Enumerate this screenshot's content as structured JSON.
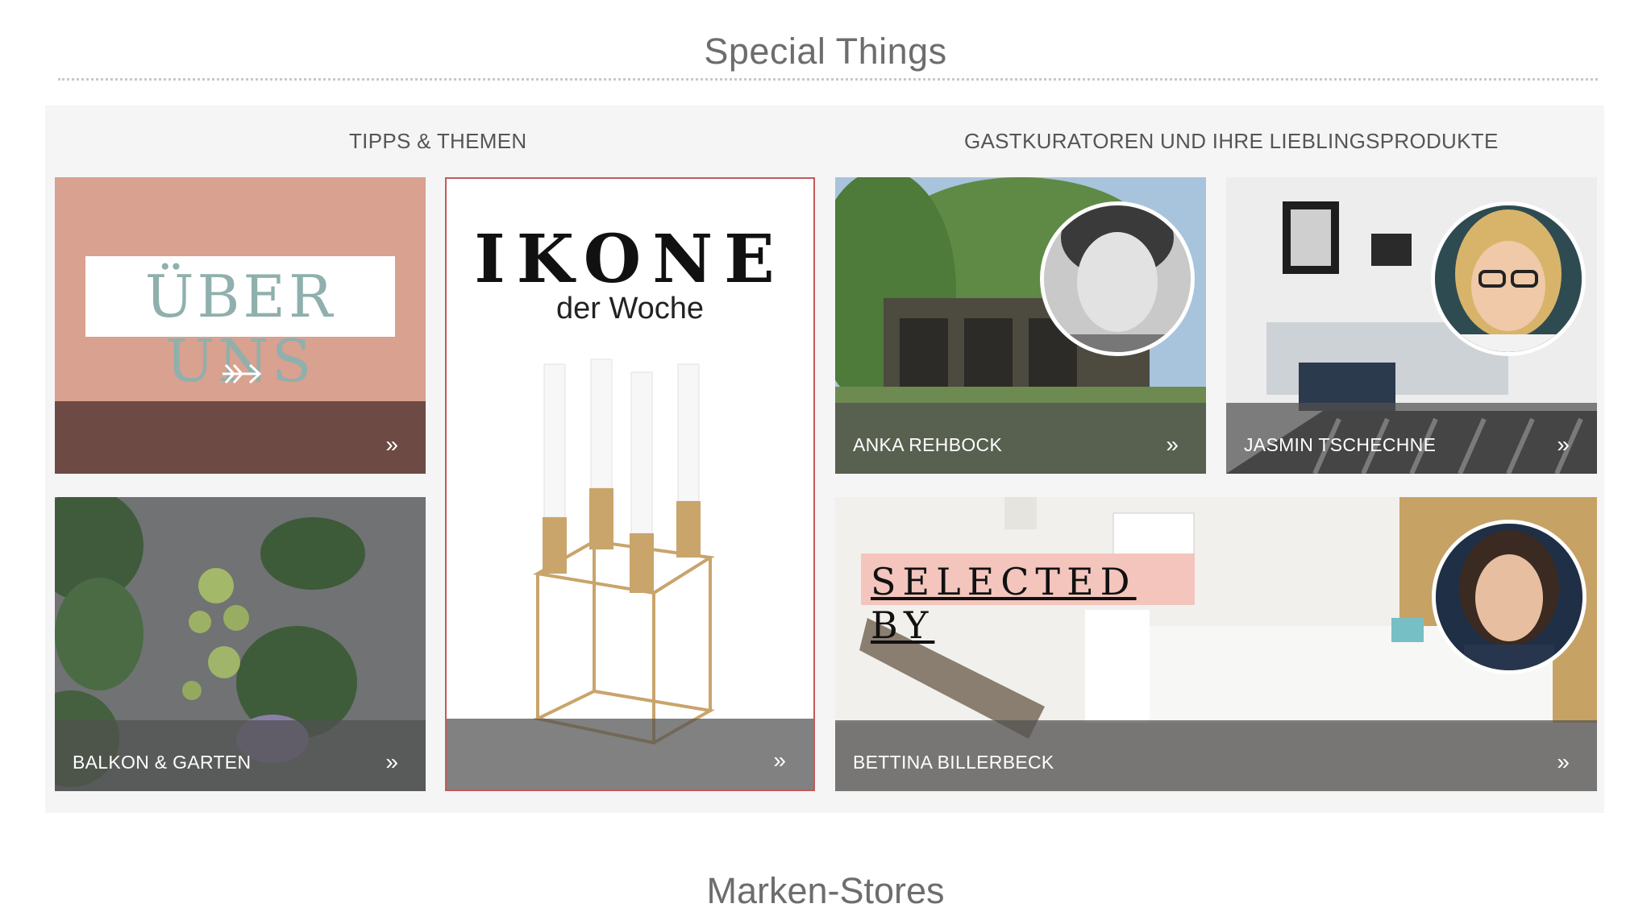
{
  "section": {
    "title": "Special Things",
    "left_heading": "TIPPS & THEMEN",
    "right_heading": "GASTKURATOREN UND IHRE LIEBLINGSPRODUKTE"
  },
  "tiles": {
    "ueber_uns": {
      "banner_text": "ÜBER UNS"
    },
    "ikone": {
      "title": "IKONE",
      "subtitle": "der Woche"
    },
    "balkon": {
      "label": "BALKON & GARTEN"
    },
    "anka": {
      "label": "ANKA REHBOCK"
    },
    "jasmin": {
      "label": "JASMIN TSCHECHNE"
    },
    "bettina": {
      "label": "BETTINA BILLERBECK",
      "banner_text": "SELECTED BY"
    }
  },
  "arrow_glyph": "»",
  "next_section": {
    "title": "Marken-Stores"
  },
  "colors": {
    "ueber_uns_pink": "#d9a18f",
    "ueber_uns_brown": "#6e4a44",
    "ikone_border": "#c45a5a",
    "selected_by_pink": "#f3c5bd",
    "accent_teal": "#8fb0ad"
  },
  "icons": [
    "arrow-right-icon",
    "double-chevron-right-icon"
  ]
}
